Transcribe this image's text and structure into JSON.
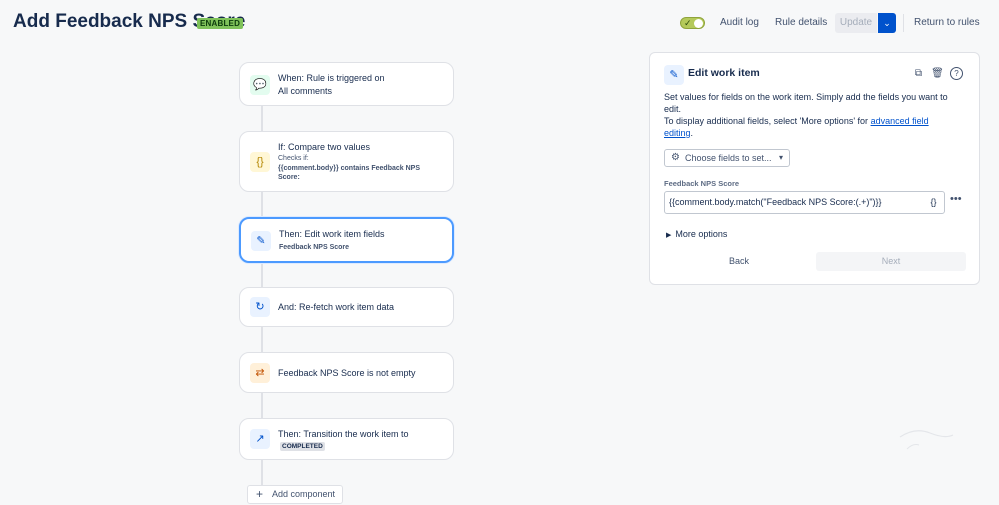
{
  "header": {
    "title": "Add Feedback NPS Score",
    "status_badge": "ENABLED",
    "audit_log": "Audit log",
    "rule_details": "Rule details",
    "update": "Update",
    "return": "Return to rules"
  },
  "flow": {
    "cards": [
      {
        "title": "When: Rule is triggered on",
        "line2": "All comments"
      },
      {
        "title": "If: Compare two values",
        "small": "Checks if:",
        "sub": "{{comment.body}} contains Feedback NPS Score:"
      },
      {
        "title": "Then: Edit work item fields",
        "sub": "Feedback NPS Score"
      },
      {
        "title": "And: Re-fetch work item data"
      },
      {
        "title": "Feedback NPS Score is not empty"
      },
      {
        "title": "Then: Transition the work item to",
        "badge": "COMPLETED"
      }
    ],
    "add_component": "Add component"
  },
  "panel": {
    "title": "Edit work item",
    "description_1": "Set values for fields on the work item. Simply add the fields you want to edit.",
    "description_2": "To display additional fields, select 'More options' for",
    "link": "advanced field editing",
    "period": ".",
    "choose_fields": "Choose fields to set...",
    "field_label": "Feedback NPS Score",
    "field_value": "{{comment.body.match(\"Feedback NPS Score:(.+)\")}}",
    "more_options": "More options",
    "back": "Back",
    "next": "Next"
  },
  "colors": {
    "primary": "#0052cc",
    "enabled_badge": "#7fc25a",
    "selected_border": "#4c9aff"
  }
}
